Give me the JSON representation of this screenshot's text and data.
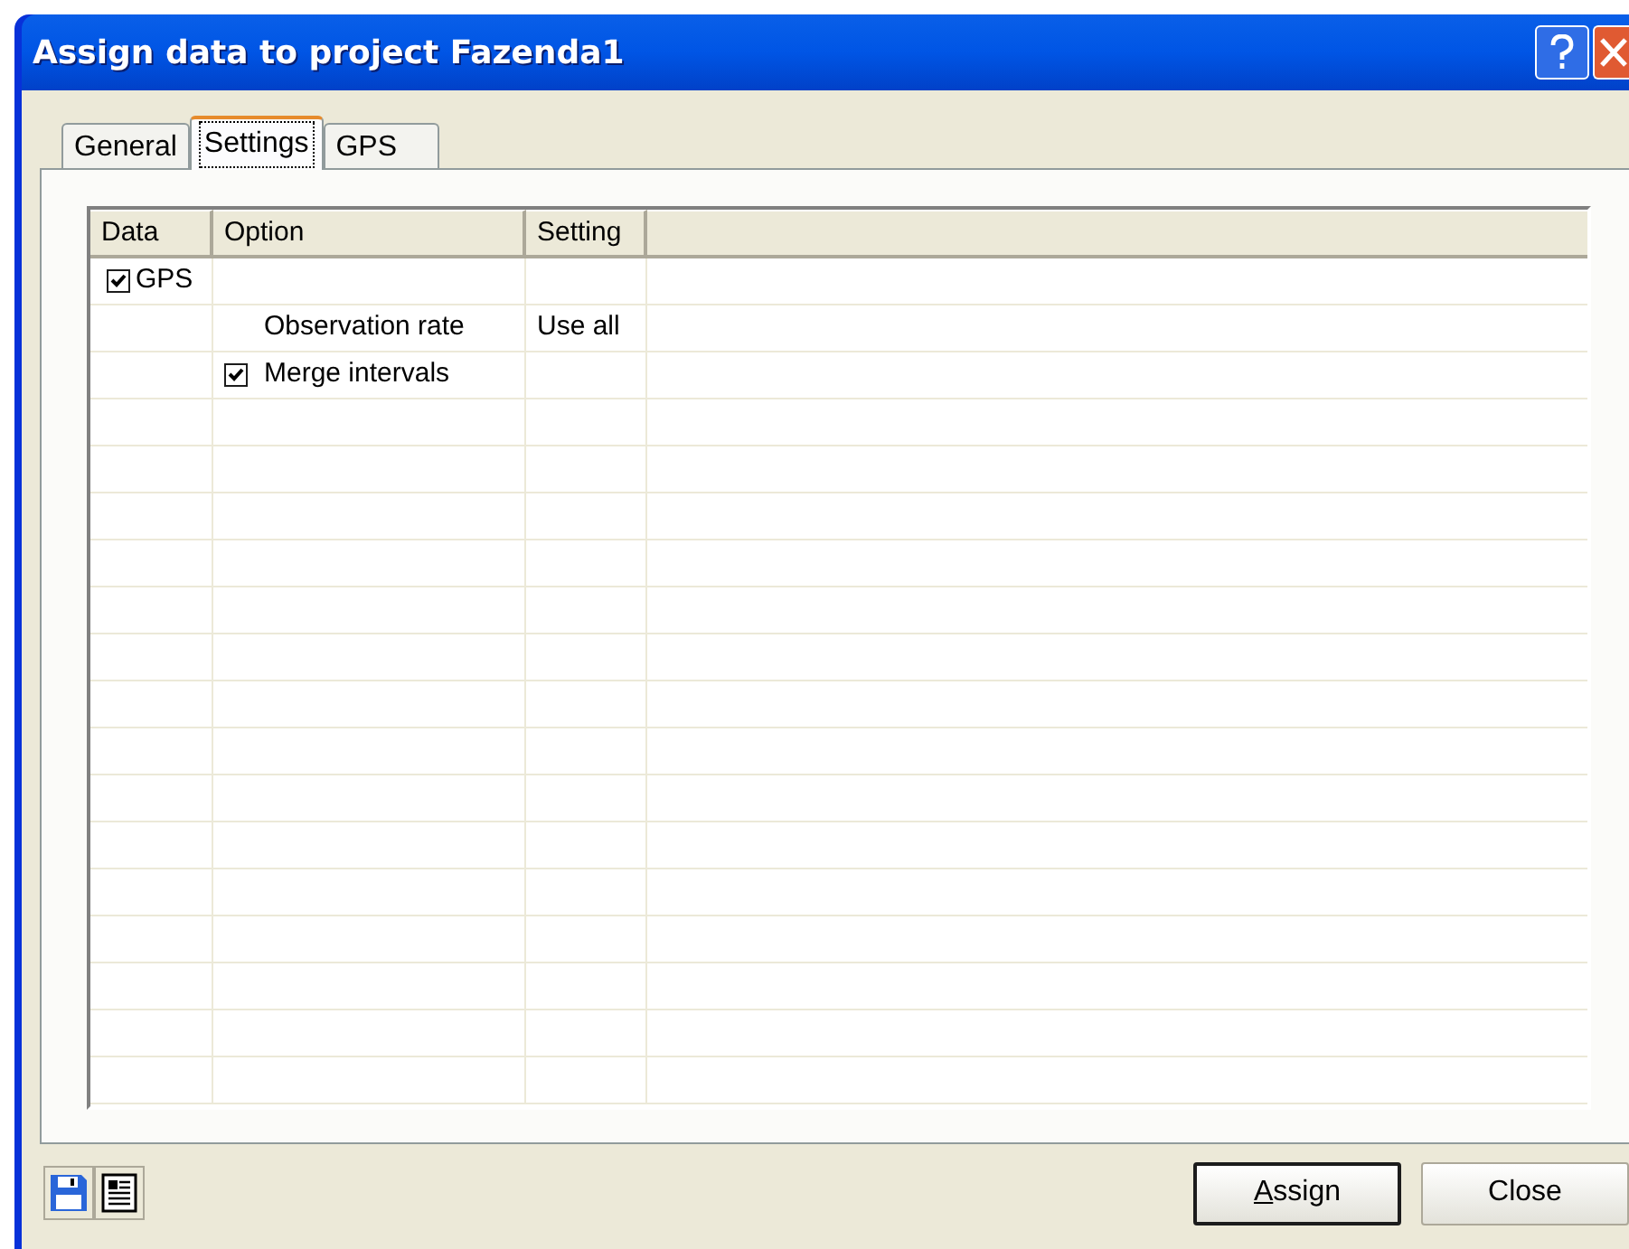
{
  "window": {
    "title": "Assign data to project Fazenda1"
  },
  "tabs": [
    {
      "label": "General",
      "selected": false
    },
    {
      "label": "Settings",
      "selected": true
    },
    {
      "label": "GPS",
      "selected": false
    }
  ],
  "table": {
    "columns": [
      "Data",
      "Option",
      "Setting"
    ],
    "rows": [
      {
        "data": {
          "checked": true,
          "label": "GPS"
        }
      },
      {
        "option": {
          "label": "Observation rate"
        },
        "setting": "Use all"
      },
      {
        "option": {
          "checked": true,
          "label": "Merge intervals"
        }
      }
    ]
  },
  "buttons": [
    {
      "label": "Assign",
      "default": true,
      "underline_first": true
    },
    {
      "label": "Close",
      "default": false,
      "underline_first": false
    }
  ]
}
